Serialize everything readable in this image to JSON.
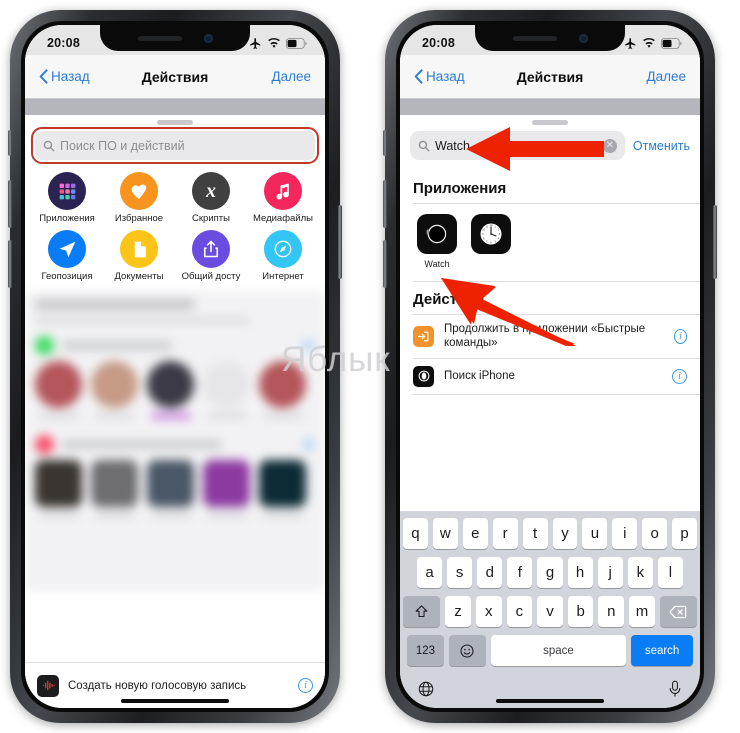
{
  "status_bar": {
    "time": "20:08",
    "icons": [
      "airplane-icon",
      "wifi-icon",
      "battery-icon"
    ]
  },
  "nav": {
    "back_label": "Назад",
    "title": "Действия",
    "next_label": "Далее"
  },
  "left_phone": {
    "search": {
      "placeholder": "Поиск ПО и действий",
      "value": "",
      "highlight_color": "#c0392b"
    },
    "grid": [
      {
        "label": "Приложения",
        "icon": "apps-grid-icon",
        "color": "#2b2352"
      },
      {
        "label": "Избранное",
        "icon": "heart-icon",
        "color": "#f7941e"
      },
      {
        "label": "Скрипты",
        "icon": "x-script-icon",
        "color": "#404040"
      },
      {
        "label": "Медиафайлы",
        "icon": "music-note-icon",
        "color": "#f5265c"
      },
      {
        "label": "Геопозиция",
        "icon": "location-arrow-icon",
        "color": "#0a7cf5"
      },
      {
        "label": "Документы",
        "icon": "document-icon",
        "color": "#fcc419"
      },
      {
        "label": "Общий досту",
        "icon": "share-icon",
        "color": "#6b4ce0"
      },
      {
        "label": "Интернет",
        "icon": "safari-compass-icon",
        "color": "#33c6f4"
      }
    ],
    "bottom_bar": {
      "label": "Создать новую голосовую запись",
      "icon": "voice-memo-icon",
      "info": "i"
    }
  },
  "right_phone": {
    "search": {
      "value": "Watch",
      "clear_icon": "clear-circle-icon",
      "cancel_label": "Отменить"
    },
    "sections": [
      {
        "title": "Приложения",
        "apps": [
          {
            "label": "Watch",
            "icon": "apple-watch-icon"
          },
          {
            "label": "",
            "icon": "clock-icon"
          }
        ]
      },
      {
        "title": "Действия",
        "actions": [
          {
            "label": "Продолжить в приложении «Быстрые команды»",
            "icon": "continue-shortcut-icon",
            "info": "i"
          },
          {
            "label": "Поиск iPhone",
            "icon": "find-iphone-icon",
            "info": "i"
          }
        ]
      }
    ],
    "keyboard": {
      "row1": [
        "q",
        "w",
        "e",
        "r",
        "t",
        "y",
        "u",
        "i",
        "o",
        "p"
      ],
      "row2": [
        "a",
        "s",
        "d",
        "f",
        "g",
        "h",
        "j",
        "k",
        "l"
      ],
      "row3": [
        "z",
        "x",
        "c",
        "v",
        "b",
        "n",
        "m"
      ],
      "shift": "shift-icon",
      "backspace": "backspace-icon",
      "numbers_label": "123",
      "emoji": "emoji-icon",
      "space_label": "space",
      "return_label": "search",
      "globe": "globe-icon",
      "dictation": "microphone-icon"
    }
  },
  "annotations": {
    "arrow_1": "red-arrow-pointing-left-at-search-field",
    "arrow_2": "red-arrow-pointing-up-left-at-watch-app"
  },
  "watermark": {
    "text": "Яблык"
  }
}
